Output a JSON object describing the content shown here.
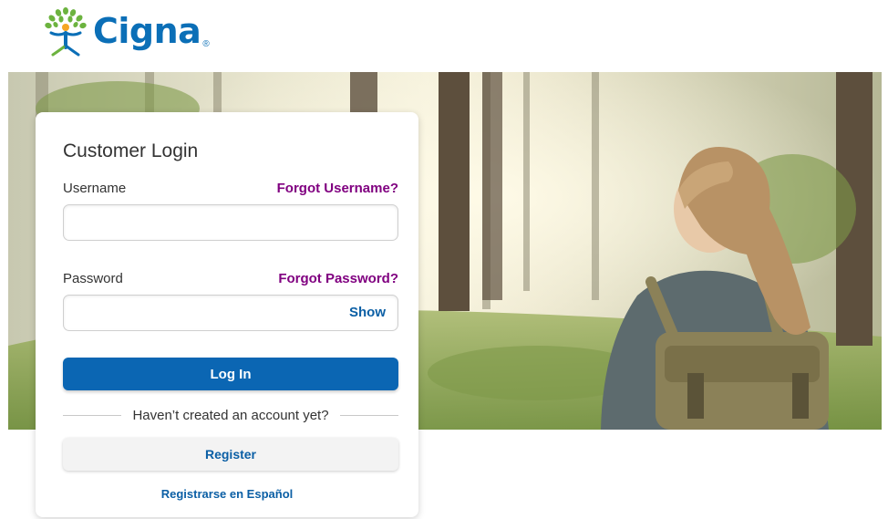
{
  "brand": {
    "name": "Cigna",
    "registered_mark": "®",
    "color_blue": "#0b6fb7",
    "color_green": "#6cb33f",
    "color_orange": "#f5a623"
  },
  "login": {
    "title": "Customer Login",
    "username_label": "Username",
    "forgot_username": "Forgot Username?",
    "username_value": "",
    "password_label": "Password",
    "forgot_password": "Forgot Password?",
    "password_value": "",
    "show_label": "Show",
    "login_button": "Log In",
    "no_account_text": "Haven’t created an account yet?",
    "register_button": "Register",
    "spanish_link": "Registrarse en Español"
  },
  "colors": {
    "primary_button": "#0b66b3",
    "link_purple": "#800080",
    "link_blue": "#0b5fa5"
  },
  "icons": {
    "logo": "cigna-tree-of-life-icon",
    "hero": "hiker-in-forest-image"
  }
}
